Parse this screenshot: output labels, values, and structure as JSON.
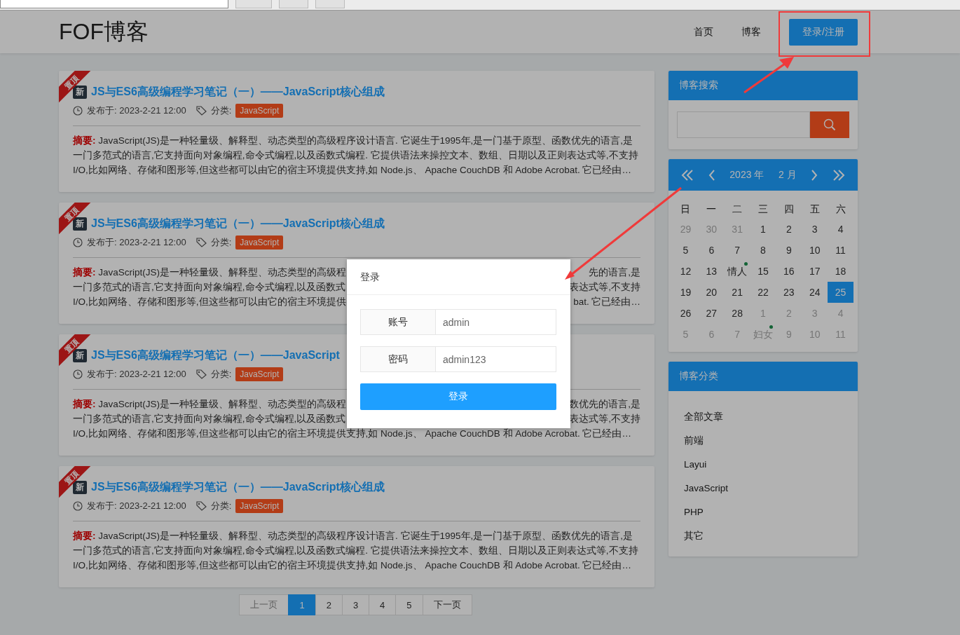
{
  "header": {
    "logo": "FOF博客",
    "nav": [
      {
        "label": "首页",
        "kind": "link"
      },
      {
        "label": "博客",
        "kind": "link"
      },
      {
        "label": "登录/注册",
        "kind": "button"
      }
    ]
  },
  "posts": [
    {
      "ribbon": "置顶",
      "badge": "新",
      "title": "JS与ES6高级编程学习笔记（一）——JavaScript核心组成",
      "published": "发布于: 2023-2-21 12:00",
      "category_label": "分类:",
      "category": "JavaScript",
      "summary_lines": [
        [
          "**摘要:** JavaScript(JS)是一种轻量级、解释型、动态类型的高级程序设计语言. 它诞生于1995年,是一门基于原型、函数优先的语言,是"
        ],
        [
          "一门多范式的语言,它支持面向对象编程,命令式编程,以及函数式编程. 它提供语法来操控文本、数组、日期以及正则表达式等,不支持"
        ],
        [
          "I/O,比如网络、存储和图形等,但这些都可以由它的宿主环境提供支持,如 Node.js、 Apache CouchDB 和 Adobe Acrobat. 它已经由…"
        ]
      ]
    },
    {
      "ribbon": "置顶",
      "badge": "新",
      "title": "JS与ES6高级编程学习笔记（一）——JavaScript核心组成",
      "published": "发布于: 2023-2-21 12:00",
      "category_label": "分类:",
      "category": "JavaScript",
      "summary_lines": [
        [
          "**摘要:** JavaScript(JS)是一种轻量级、解释型、动态类型的高级程",
          "先的语言,是"
        ],
        [
          "一门多范式的语言,它支持面向对象编程,命令式编程,以及函数式",
          "表达式等,不支持"
        ],
        [
          "I/O,比如网络、存储和图形等,但这些都可以由它的宿主环境提供",
          "bat. 它已经由…"
        ]
      ]
    },
    {
      "ribbon": "置顶",
      "badge": "新",
      "title": "JS与ES6高级编程学习笔记（一）——JavaScript",
      "published": "发布于: 2023-2-21 12:00",
      "category_label": "分类:",
      "category": "JavaScript",
      "summary_lines": [
        [
          "**摘要:** JavaScript(JS)是一种轻量级、解释型、动态类型的高级程",
          "数优先的语言,是"
        ],
        [
          "一门多范式的语言,它支持面向对象编程,命令式编程,以及函数式",
          "表达式等,不支持"
        ],
        [
          "I/O,比如网络、存储和图形等,但这些都可以由它的宿主环境提供支持,如 Node.js、 Apache CouchDB 和 Adobe Acrobat. 它已经由…"
        ]
      ]
    },
    {
      "ribbon": "置顶",
      "badge": "新",
      "title": "JS与ES6高级编程学习笔记（一）——JavaScript核心组成",
      "published": "发布于: 2023-2-21 12:00",
      "category_label": "分类:",
      "category": "JavaScript",
      "summary_lines": [
        [
          "**摘要:** JavaScript(JS)是一种轻量级、解释型、动态类型的高级程序设计语言. 它诞生于1995年,是一门基于原型、函数优先的语言,是"
        ],
        [
          "一门多范式的语言,它支持面向对象编程,命令式编程,以及函数式编程. 它提供语法来操控文本、数组、日期以及正则表达式等,不支持"
        ],
        [
          "I/O,比如网络、存储和图形等,但这些都可以由它的宿主环境提供支持,如 Node.js、 Apache CouchDB 和 Adobe Acrobat. 它已经由…"
        ]
      ]
    }
  ],
  "pagination": [
    {
      "label": "上一页",
      "disabled": true,
      "selected": false
    },
    {
      "label": "1",
      "disabled": false,
      "selected": true
    },
    {
      "label": "2",
      "disabled": false,
      "selected": false
    },
    {
      "label": "3",
      "disabled": false,
      "selected": false
    },
    {
      "label": "4",
      "disabled": false,
      "selected": false
    },
    {
      "label": "5",
      "disabled": false,
      "selected": false
    },
    {
      "label": "下一页",
      "disabled": false,
      "selected": false
    }
  ],
  "search_panel": {
    "title": "博客搜索"
  },
  "calendar": {
    "year": "2023 年",
    "month": "2 月",
    "weekdays": [
      "日",
      "一",
      "二",
      "三",
      "四",
      "五",
      "六"
    ],
    "days": [
      {
        "text": "29",
        "other_month": true,
        "selected": false,
        "festival": false
      },
      {
        "text": "30",
        "other_month": true,
        "selected": false,
        "festival": false
      },
      {
        "text": "31",
        "other_month": true,
        "selected": false,
        "festival": false
      },
      {
        "text": "1",
        "other_month": false,
        "selected": false,
        "festival": false
      },
      {
        "text": "2",
        "other_month": false,
        "selected": false,
        "festival": false
      },
      {
        "text": "3",
        "other_month": false,
        "selected": false,
        "festival": false
      },
      {
        "text": "4",
        "other_month": false,
        "selected": false,
        "festival": false
      },
      {
        "text": "5",
        "other_month": false,
        "selected": false,
        "festival": false
      },
      {
        "text": "6",
        "other_month": false,
        "selected": false,
        "festival": false
      },
      {
        "text": "7",
        "other_month": false,
        "selected": false,
        "festival": false
      },
      {
        "text": "8",
        "other_month": false,
        "selected": false,
        "festival": false
      },
      {
        "text": "9",
        "other_month": false,
        "selected": false,
        "festival": false
      },
      {
        "text": "10",
        "other_month": false,
        "selected": false,
        "festival": false
      },
      {
        "text": "11",
        "other_month": false,
        "selected": false,
        "festival": false
      },
      {
        "text": "12",
        "other_month": false,
        "selected": false,
        "festival": false
      },
      {
        "text": "13",
        "other_month": false,
        "selected": false,
        "festival": false
      },
      {
        "text": "情人",
        "other_month": false,
        "selected": false,
        "festival": true
      },
      {
        "text": "15",
        "other_month": false,
        "selected": false,
        "festival": false
      },
      {
        "text": "16",
        "other_month": false,
        "selected": false,
        "festival": false
      },
      {
        "text": "17",
        "other_month": false,
        "selected": false,
        "festival": false
      },
      {
        "text": "18",
        "other_month": false,
        "selected": false,
        "festival": false
      },
      {
        "text": "19",
        "other_month": false,
        "selected": false,
        "festival": false
      },
      {
        "text": "20",
        "other_month": false,
        "selected": false,
        "festival": false
      },
      {
        "text": "21",
        "other_month": false,
        "selected": false,
        "festival": false
      },
      {
        "text": "22",
        "other_month": false,
        "selected": false,
        "festival": false
      },
      {
        "text": "23",
        "other_month": false,
        "selected": false,
        "festival": false
      },
      {
        "text": "24",
        "other_month": false,
        "selected": false,
        "festival": false
      },
      {
        "text": "25",
        "other_month": false,
        "selected": true,
        "festival": false
      },
      {
        "text": "26",
        "other_month": false,
        "selected": false,
        "festival": false
      },
      {
        "text": "27",
        "other_month": false,
        "selected": false,
        "festival": false
      },
      {
        "text": "28",
        "other_month": false,
        "selected": false,
        "festival": false
      },
      {
        "text": "1",
        "other_month": true,
        "selected": false,
        "festival": false
      },
      {
        "text": "2",
        "other_month": true,
        "selected": false,
        "festival": false
      },
      {
        "text": "3",
        "other_month": true,
        "selected": false,
        "festival": false
      },
      {
        "text": "4",
        "other_month": true,
        "selected": false,
        "festival": false
      },
      {
        "text": "5",
        "other_month": true,
        "selected": false,
        "festival": false
      },
      {
        "text": "6",
        "other_month": true,
        "selected": false,
        "festival": false
      },
      {
        "text": "7",
        "other_month": true,
        "selected": false,
        "festival": false
      },
      {
        "text": "妇女",
        "other_month": true,
        "selected": false,
        "festival": true
      },
      {
        "text": "9",
        "other_month": true,
        "selected": false,
        "festival": false
      },
      {
        "text": "10",
        "other_month": true,
        "selected": false,
        "festival": false
      },
      {
        "text": "11",
        "other_month": true,
        "selected": false,
        "festival": false
      }
    ]
  },
  "categories_panel": {
    "title": "博客分类",
    "items": [
      "全部文章",
      "前端",
      "Layui",
      "JavaScript",
      "PHP",
      "其它"
    ]
  },
  "login_dialog": {
    "title": "登录",
    "fields": [
      {
        "label": "账号",
        "value": "admin"
      },
      {
        "label": "密码",
        "value": "admin123"
      }
    ],
    "submit": "登录"
  }
}
